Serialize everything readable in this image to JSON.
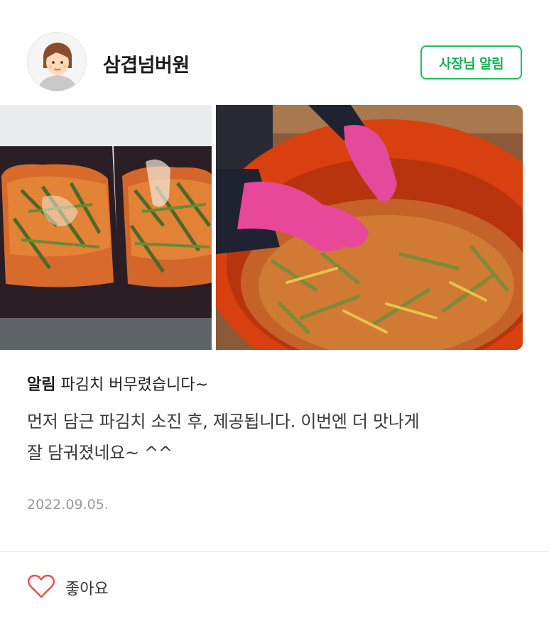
{
  "post": {
    "author_name": "삼겹넘버원",
    "owner_badge": "사장님 알림",
    "title_tag": "알림",
    "title": "파김치 버무렸습니다~",
    "body_line_1": "먼저 담근 파김치 소진 후, 제공됩니다. 이번엔 더 맛나게",
    "body_line_2": "잘 담궈졌네요~ ^^",
    "date": "2022.09.05.",
    "like_label": "좋아요"
  },
  "icons": {
    "like": "heart-outline-icon"
  },
  "colors": {
    "badge_green": "#1fbf5f",
    "heart_red": "#e8504f",
    "date_gray": "#9a9a9a"
  }
}
